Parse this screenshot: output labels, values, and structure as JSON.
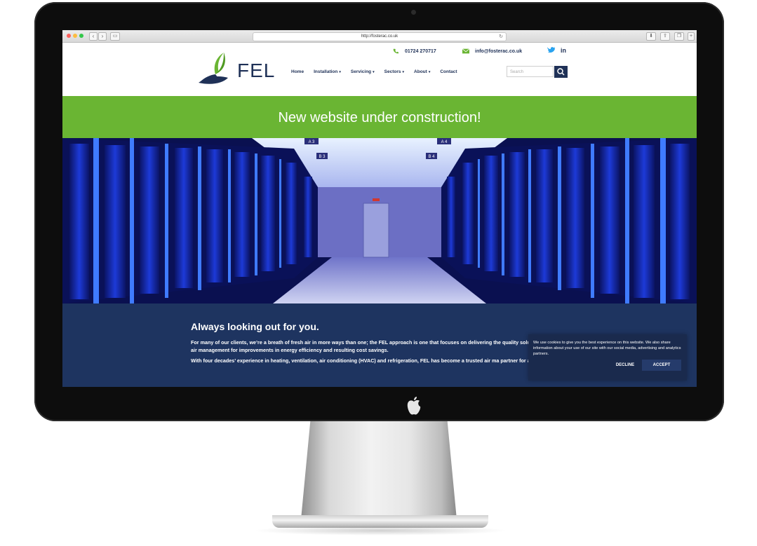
{
  "browser": {
    "url": "http://fosterac.co.uk"
  },
  "header": {
    "logo_text": "FEL",
    "phone": "01724 270717",
    "email": "info@fosterac.co.uk",
    "search_placeholder": "Search",
    "nav": [
      {
        "label": "Home"
      },
      {
        "label": "Installation",
        "caret": "▾"
      },
      {
        "label": "Servicing",
        "caret": "▾"
      },
      {
        "label": "Sectors",
        "caret": "▾"
      },
      {
        "label": "About",
        "caret": "▾"
      },
      {
        "label": "Contact"
      }
    ]
  },
  "banner": {
    "text": "New website under construction!"
  },
  "hero": {
    "aisle_labels": [
      "A 3",
      "A 4",
      "B 3",
      "B 4"
    ]
  },
  "intro": {
    "title": "Always looking out for you.",
    "p1": "For many of our clients, we’re a breath of fresh air in more ways than one; the FEL approach is one that focuses on delivering the quality solutions in air management for improvements in energy efficiency and resulting cost savings.",
    "p2": "With four decades’ experience in heating, ventilation, air conditioning (HVAC) and refrigeration, FEL has become a trusted air ma partner for a wide variety of businesses from offices and manufacturing plants to specialist data centres and mission critical en"
  },
  "cookie": {
    "text": "We use cookies to give you the best experience on this website. We also share information about your use of our site with our social media, advertising and analytics partners.",
    "decline": "DECLINE",
    "accept": "ACCEPT"
  },
  "colors": {
    "brand_navy": "#1f3157",
    "brand_green": "#6ab533",
    "intro_bg": "#1e3460"
  }
}
